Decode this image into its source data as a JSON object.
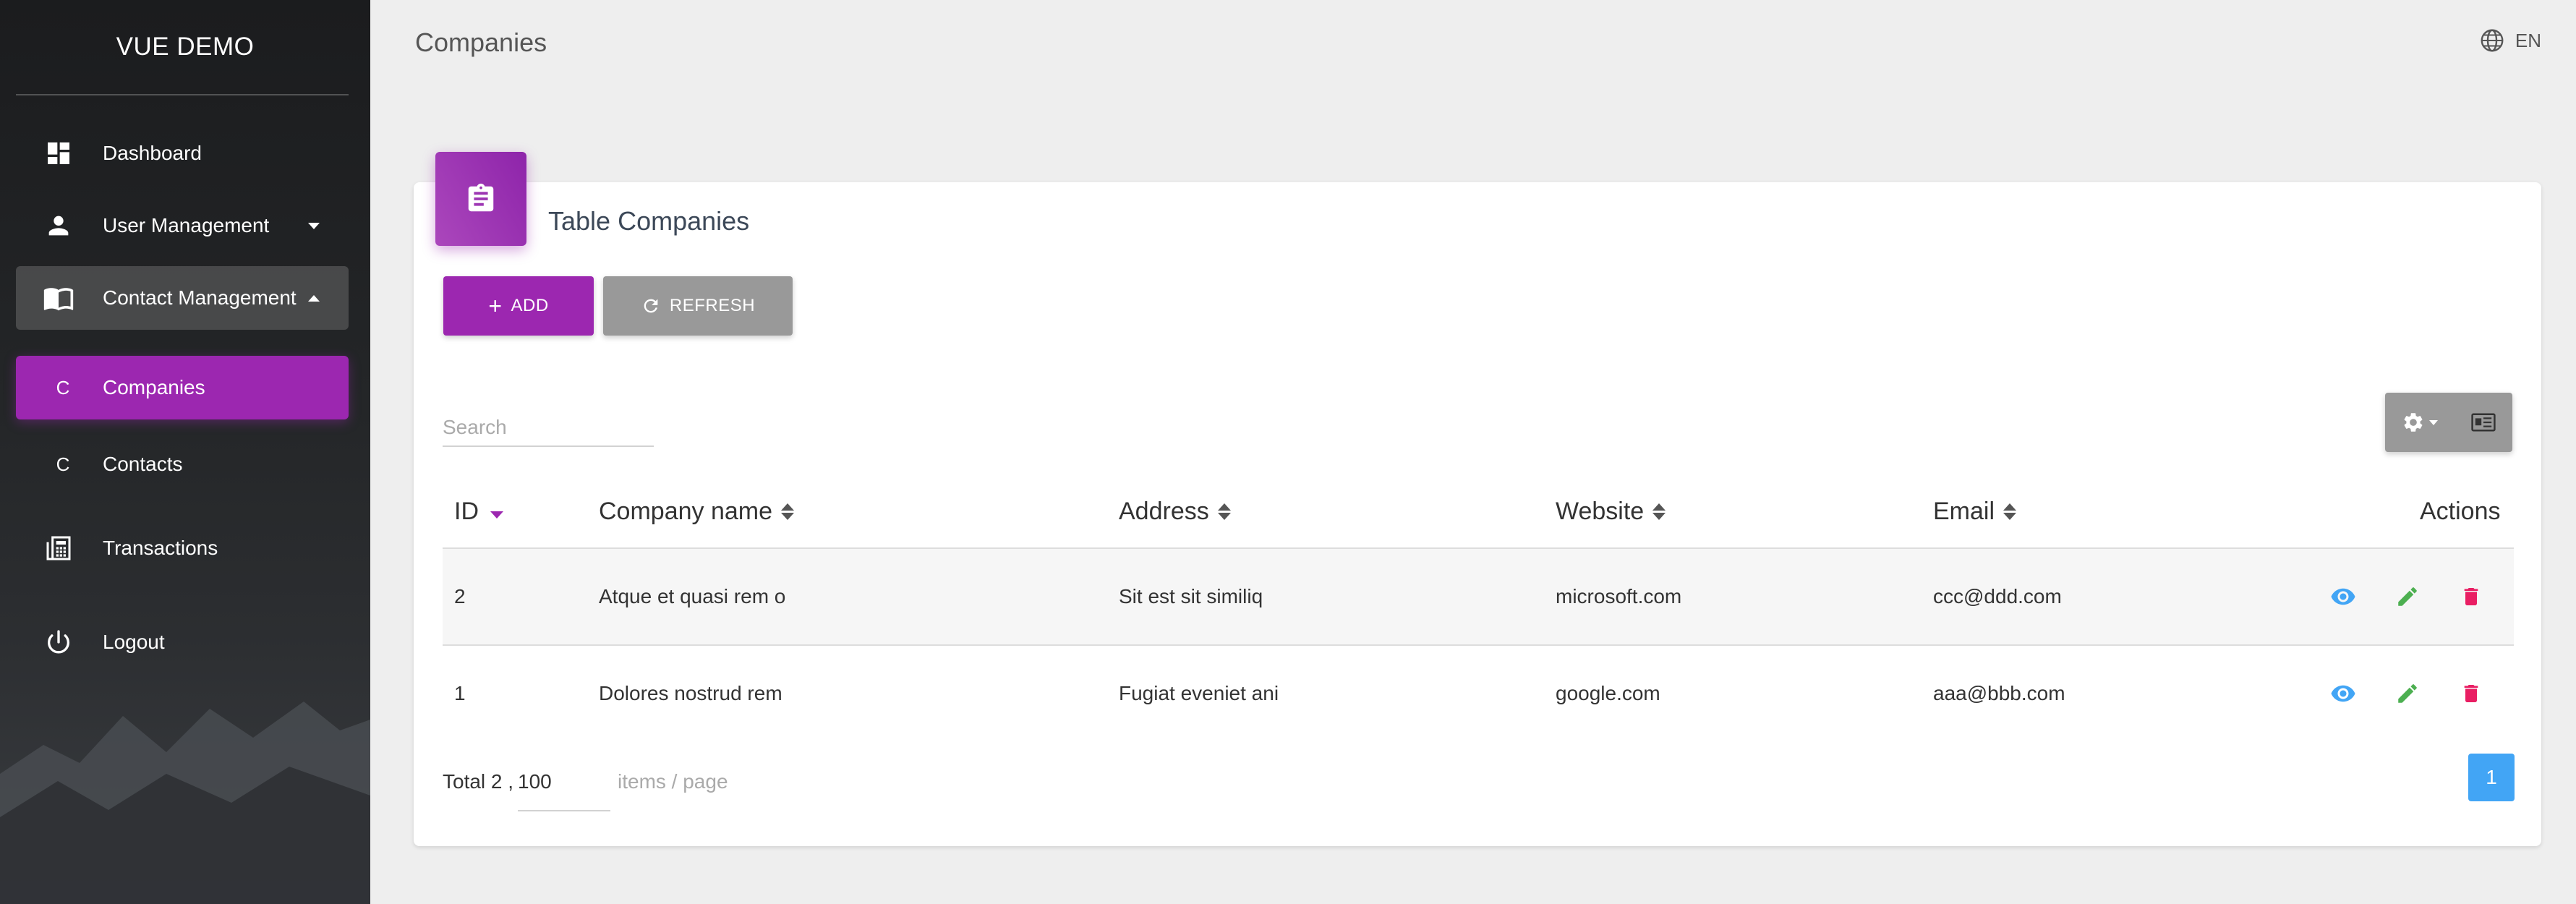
{
  "sidebar": {
    "brand": "VUE DEMO",
    "items": [
      {
        "label": "Dashboard",
        "icon": "dashboard-icon"
      },
      {
        "label": "User Management",
        "icon": "person-icon"
      },
      {
        "label": "Contact Management",
        "icon": "book-icon"
      },
      {
        "label": "Companies",
        "mini": "C"
      },
      {
        "label": "Contacts",
        "mini": "C"
      },
      {
        "label": "Transactions",
        "icon": "calculator-icon"
      },
      {
        "label": "Logout",
        "icon": "power-icon"
      }
    ],
    "accent": "#9c27b0"
  },
  "topbar": {
    "title": "Companies",
    "lang": "EN"
  },
  "card": {
    "title_prefix": "Table",
    "title_main": "Companies",
    "add_label": "ADD",
    "refresh_label": "REFRESH",
    "search_placeholder": "Search"
  },
  "table": {
    "columns": [
      "ID",
      "Company name",
      "Address",
      "Website",
      "Email",
      "Actions"
    ],
    "rows": [
      {
        "id": "2",
        "name": "Atque et quasi rem o",
        "address": "Sit est sit similiq",
        "website": "microsoft.com",
        "email": "ccc@ddd.com"
      },
      {
        "id": "1",
        "name": "Dolores nostrud rem",
        "address": "Fugiat eveniet ani",
        "website": "google.com",
        "email": "aaa@bbb.com"
      }
    ]
  },
  "footer": {
    "total": "Total 2 ,",
    "page_size": "100",
    "items_per_page": "items / page",
    "current_page": "1"
  },
  "colors": {
    "view": "#42a5f5",
    "edit": "#4caf50",
    "delete": "#e91e63",
    "primary": "#9c27b0"
  }
}
